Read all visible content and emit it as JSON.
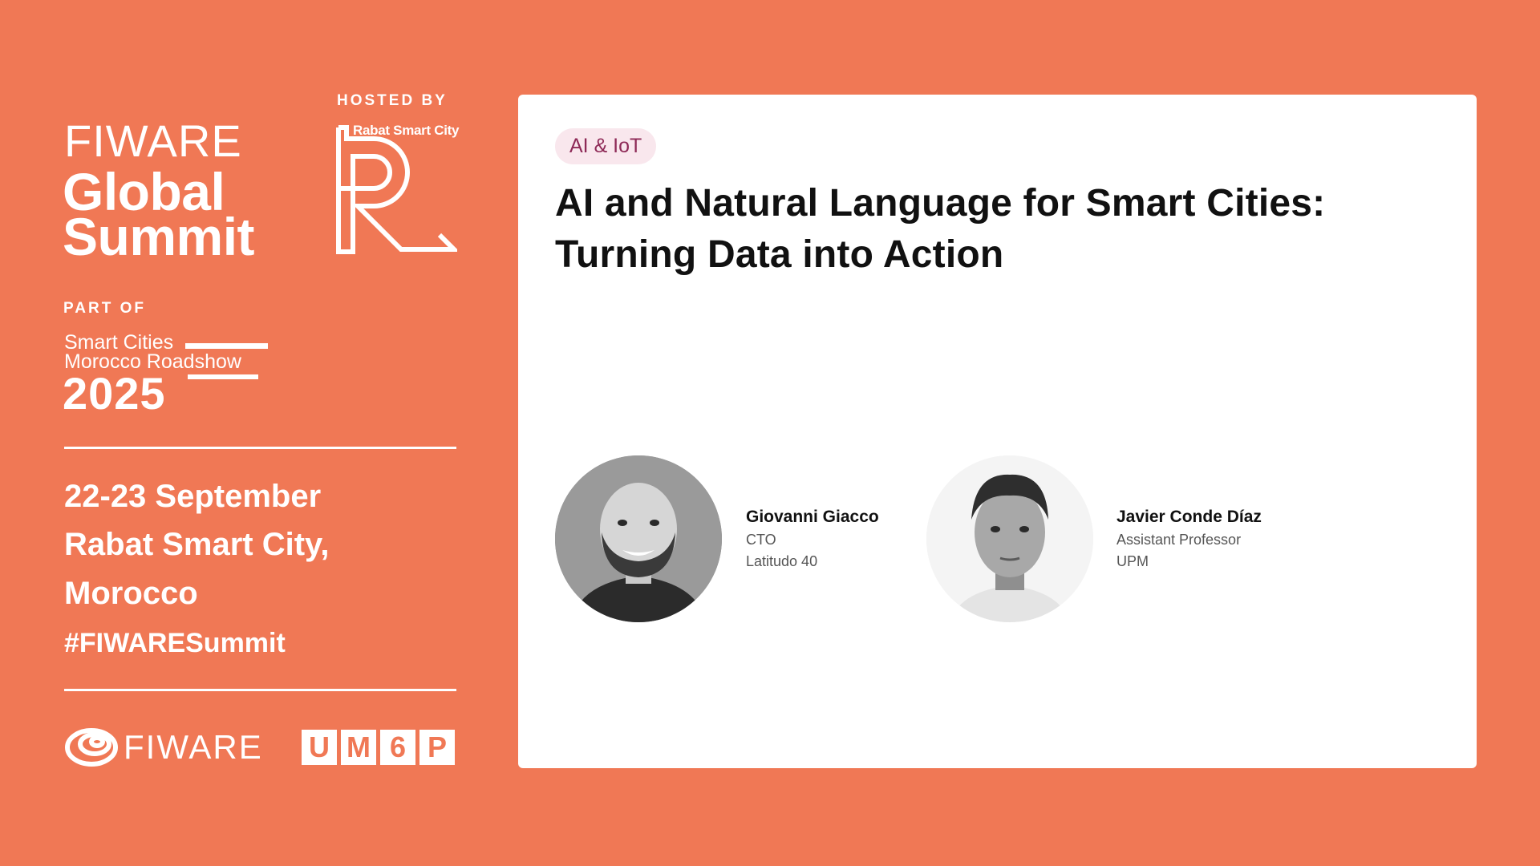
{
  "event": {
    "brand_word": "FIWARE",
    "name_line_1": "Global",
    "name_line_2": "Summit"
  },
  "host": {
    "label": "HOSTED BY",
    "name": "Rabat Smart City"
  },
  "roadshow": {
    "label": "PART OF",
    "line_1": "Smart Cities",
    "line_2": "Morocco Roadshow",
    "year": "2025"
  },
  "details": {
    "date": "22-23 September",
    "venue_line_1": "Rabat Smart City,",
    "venue_line_2": "Morocco",
    "hashtag": "#FIWARESummit"
  },
  "logos": {
    "fiware": "FIWARE",
    "um6p_letters": [
      "U",
      "M",
      "6",
      "P"
    ]
  },
  "talk": {
    "tag": "AI & IoT",
    "title": "AI and Natural Language for Smart Cities: Turning Data into Action",
    "speakers": [
      {
        "name": "Giovanni Giacco",
        "role": "CTO",
        "org": "Latitudo 40"
      },
      {
        "name": "Javier Conde Díaz",
        "role": "Assistant Professor",
        "org": "UPM"
      }
    ]
  },
  "colors": {
    "background": "#F07855",
    "card": "#ffffff",
    "tag_bg": "#F9E7ED",
    "tag_text": "#8E2A57"
  }
}
